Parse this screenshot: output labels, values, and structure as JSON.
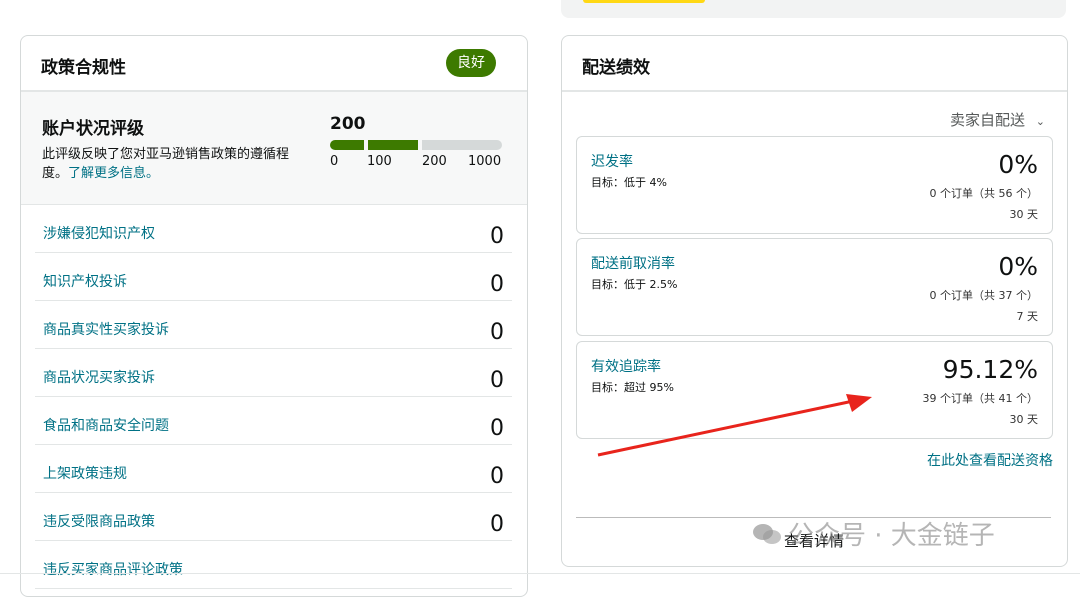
{
  "policy": {
    "title": "政策合规性",
    "badge": "良好",
    "rating_title": "账户状况评级",
    "rating_desc": "此评级反映了您对亚马逊销售政策的遵循程度。",
    "learn_more": "了解更多信息。",
    "score": "200",
    "scale": [
      "0",
      "100",
      "200",
      "1000"
    ],
    "items": [
      {
        "label": "涉嫌侵犯知识产权",
        "value": "0"
      },
      {
        "label": "知识产权投诉",
        "value": "0"
      },
      {
        "label": "商品真实性买家投诉",
        "value": "0"
      },
      {
        "label": "商品状况买家投诉",
        "value": "0"
      },
      {
        "label": "食品和商品安全问题",
        "value": "0"
      },
      {
        "label": "上架政策违规",
        "value": "0"
      },
      {
        "label": "违反受限商品政策",
        "value": "0"
      },
      {
        "label": "违反买家商品评论政策",
        "value": ""
      }
    ]
  },
  "shipping": {
    "title": "配送绩效",
    "selector": "卖家自配送",
    "metrics": [
      {
        "name": "迟发率",
        "target": "目标：低于 4%",
        "value": "0%",
        "orders": "0 个订单（共 56 个）",
        "days": "30 天"
      },
      {
        "name": "配送前取消率",
        "target": "目标：低于 2.5%",
        "value": "0%",
        "orders": "0 个订单（共 37 个）",
        "days": "7 天"
      },
      {
        "name": "有效追踪率",
        "target": "目标：超过 95%",
        "value": "95.12%",
        "orders": "39 个订单（共 41 个）",
        "days": "30 天"
      }
    ],
    "eligibility_link": "在此处查看配送资格",
    "details_link": "查看详情"
  },
  "watermark": "公众号 · 大金链子",
  "colors": {
    "good_green": "#3d7a00",
    "link": "#007185",
    "arrow": "#e8241c"
  }
}
